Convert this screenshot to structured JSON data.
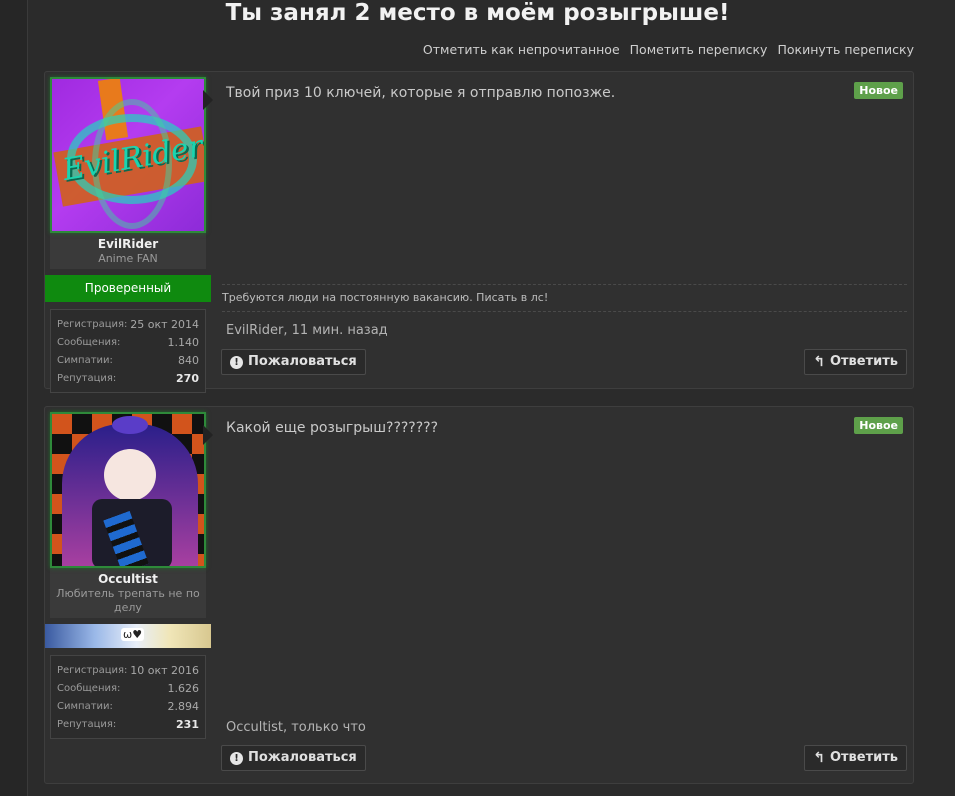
{
  "page": {
    "title": "Ты занял 2 место в моём розыгрыше!"
  },
  "actions": {
    "mark_unread": "Отметить как непрочитанное",
    "mark_conversation": "Пометить переписку",
    "leave_conversation": "Покинуть переписку"
  },
  "posts": [
    {
      "username": "EvilRider",
      "user_title": "Anime FAN",
      "avatar_text": "EvilRider",
      "banner": "Проверенный",
      "badge": "Новое",
      "message": "Твой приз 10 ключей, которые я отправлю попозже.",
      "signature": "Требуются люди на постоянную вакансию. Писать в лс!",
      "meta": "EvilRider, 11 мин. назад",
      "report_label": "Пожаловаться",
      "reply_label": "Ответить",
      "stats": [
        {
          "label": "Регистрация:",
          "value": "25 окт 2014"
        },
        {
          "label": "Сообщения:",
          "value": "1.140"
        },
        {
          "label": "Симпатии:",
          "value": "840"
        },
        {
          "label": "Репутация:",
          "value": "270"
        }
      ]
    },
    {
      "username": "Occultist",
      "user_title": "Любитель трепать не по делу",
      "banner_icon": "ω♥",
      "badge": "Новое",
      "message": "Какой еще розыгрыш???????",
      "meta": "Occultist, только что",
      "report_label": "Пожаловаться",
      "reply_label": "Ответить",
      "stats": [
        {
          "label": "Регистрация:",
          "value": "10 окт 2016"
        },
        {
          "label": "Сообщения:",
          "value": "1.626"
        },
        {
          "label": "Симпатии:",
          "value": "2.894"
        },
        {
          "label": "Репутация:",
          "value": "231"
        }
      ]
    }
  ],
  "colors": {
    "background": "#2b2b2b",
    "verified_banner": "#0f8a0f",
    "new_badge": "#5ea04a"
  }
}
